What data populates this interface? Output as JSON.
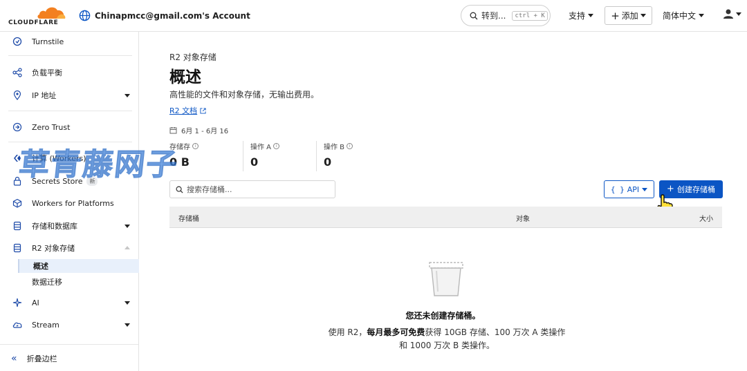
{
  "topbar": {
    "logo_text": "CLOUDFLARE",
    "account_name": "Chinapmcc@gmail.com's Account",
    "goto_label": "转到...",
    "goto_shortcut": "ctrl + K",
    "support_label": "支持",
    "add_label": "添加",
    "language_label": "简体中文"
  },
  "sidebar": {
    "items": [
      {
        "label": "Turnstile",
        "icon": "turnstile-icon"
      },
      {
        "label": "负载平衡",
        "icon": "load-balancing-icon"
      },
      {
        "label": "IP 地址",
        "icon": "location-pin-icon"
      },
      {
        "label": "Zero Trust",
        "icon": "zero-trust-icon"
      },
      {
        "label": "计算 (Workers)",
        "icon": "workers-icon"
      },
      {
        "label": "Secrets Store",
        "icon": "lock-icon",
        "badge": "新"
      },
      {
        "label": "Workers for Platforms",
        "icon": "cube-icon"
      },
      {
        "label": "存储和数据库",
        "icon": "database-icon"
      },
      {
        "label": "R2 对象存储",
        "icon": "database-icon"
      },
      {
        "label": "AI",
        "icon": "sparkle-icon"
      },
      {
        "label": "Stream",
        "icon": "cloud-stream-icon"
      }
    ],
    "r2_sub": [
      {
        "label": "概述"
      },
      {
        "label": "数据迁移"
      }
    ],
    "collapse_label": "折叠边栏"
  },
  "main": {
    "eyebrow": "R2 对象存储",
    "title": "概述",
    "description": "高性能的文件和对象存储，无输出费用。",
    "doc_link": "R2 文档",
    "date_range": "6月 1 - 6月 16",
    "stats": [
      {
        "label": "存储存",
        "value": "0 B"
      },
      {
        "label": "操作 A",
        "value": "0"
      },
      {
        "label": "操作 B",
        "value": "0"
      }
    ],
    "search_placeholder": "搜索存储桶...",
    "api_label": "API",
    "create_label": "创建存储桶",
    "table_columns": [
      "存储桶",
      "对象",
      "大小"
    ],
    "empty_title": "您还未创建存储桶。",
    "empty_desc_prefix": "使用 R2，",
    "empty_desc_bold": "每月最多可免费",
    "empty_desc_suffix": "获得 10GB 存储、100 万次 A 类操作和 1000 万次 B 类操作。"
  },
  "watermark": "草青藤网子",
  "colors": {
    "accent": "#0b55c4",
    "brand_orange": "#f38020"
  }
}
